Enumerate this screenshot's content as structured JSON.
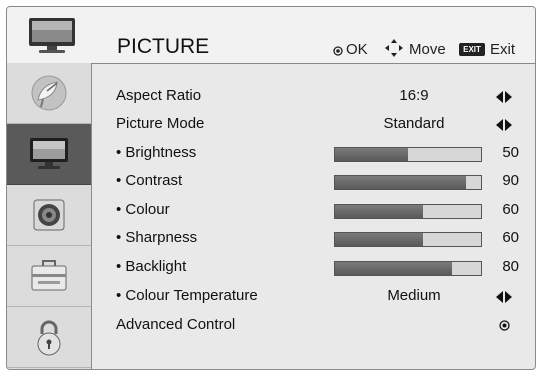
{
  "header": {
    "title": "PICTURE",
    "hints": [
      {
        "icon": "ok-dot-icon",
        "label": "OK"
      },
      {
        "icon": "move-arrows-icon",
        "label": "Move"
      },
      {
        "icon": "exit-key-icon",
        "key": "EXIT",
        "label": "Exit"
      }
    ]
  },
  "sidebar": {
    "tabs": [
      {
        "icon": "satellite-dish-icon",
        "active": false
      },
      {
        "icon": "tv-picture-icon",
        "active": true
      },
      {
        "icon": "speaker-icon",
        "active": false
      },
      {
        "icon": "toolbox-icon",
        "active": false
      },
      {
        "icon": "padlock-icon",
        "active": false
      }
    ]
  },
  "menu": {
    "items": [
      {
        "label": "Aspect Ratio",
        "value": "16:9",
        "control": "arrows"
      },
      {
        "label": "Picture Mode",
        "value": "Standard",
        "control": "arrows"
      },
      {
        "label": "• Brightness",
        "level": 50,
        "control": "slider"
      },
      {
        "label": "• Contrast",
        "level": 90,
        "control": "slider"
      },
      {
        "label": "• Colour",
        "level": 60,
        "control": "slider"
      },
      {
        "label": "• Sharpness",
        "level": 60,
        "control": "slider"
      },
      {
        "label": "• Backlight",
        "level": 80,
        "control": "slider"
      },
      {
        "label": "• Colour Temperature",
        "value": "Medium",
        "control": "arrows"
      },
      {
        "label": "Advanced Control",
        "control": "ok"
      }
    ]
  }
}
